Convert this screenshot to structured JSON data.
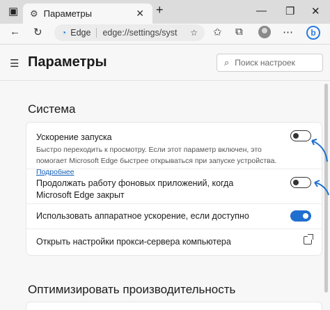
{
  "browser": {
    "tab": {
      "title": "Параметры",
      "icon": "gear-icon"
    },
    "new_tab_icon": "plus-icon",
    "window_controls": [
      "minimize-icon",
      "restore-icon",
      "close-icon"
    ],
    "address": {
      "site_name": "Edge",
      "url": "edge://settings/system"
    },
    "bing_label": "b"
  },
  "settings": {
    "title": "Параметры",
    "search_placeholder": "Поиск настроек",
    "section_title": "Система",
    "rows": [
      {
        "title": "Ускорение запуска",
        "description": "Быстро переходить к просмотру. Если этот параметр включен, это помогает Microsoft Edge быстрее открываться при запуске устройства.",
        "link": "Подробнее",
        "enabled": false
      },
      {
        "title": "Продолжать работу фоновых приложений, когда Microsoft Edge закрыт",
        "enabled": false
      },
      {
        "title": "Использовать аппаратное ускорение, если доступно",
        "enabled": true
      },
      {
        "title": "Открыть настройки прокси-сервера компьютера",
        "icon": "external-link-icon"
      }
    ],
    "section2_title": "Оптимизировать производительность"
  },
  "colors": {
    "accent": "#1f6fd0",
    "annotation_arrow": "#1f6fd0"
  }
}
